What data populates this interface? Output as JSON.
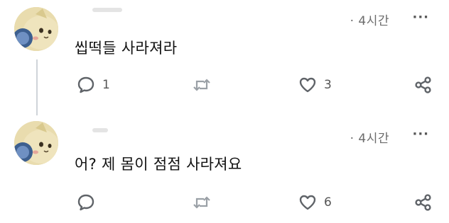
{
  "posts": [
    {
      "time": "· 4시간",
      "more": "···",
      "content": "씹떡들 사라져라",
      "reply_count": "1",
      "repost_count": "",
      "like_count": "3"
    },
    {
      "time": "· 4시간",
      "more": "···",
      "content": "어? 제 몸이 점점 사라져요",
      "reply_count": "",
      "repost_count": "",
      "like_count": "6"
    }
  ],
  "icons": {
    "reply": "speech-bubble-icon",
    "repost": "repost-arrows-icon",
    "like": "heart-icon",
    "share": "share-icon",
    "more": "more-dots-icon"
  },
  "colors": {
    "icon": "#6b6b6b",
    "thread_line": "#cfd4d9"
  }
}
